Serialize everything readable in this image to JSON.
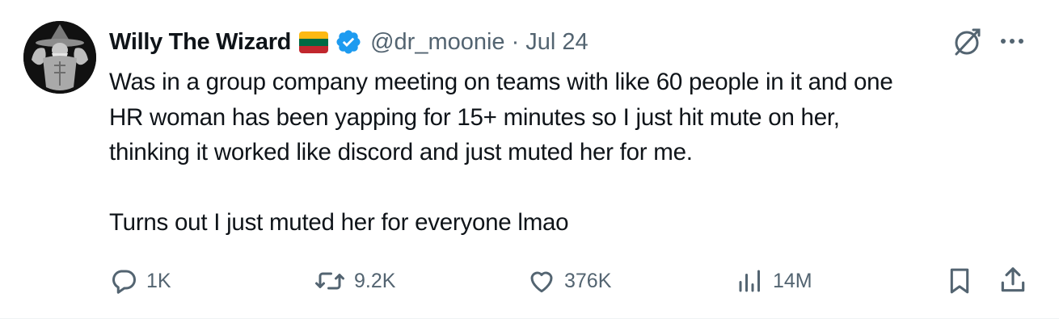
{
  "author": {
    "name": "Willy The Wizard",
    "flag_icon": "lithuania-flag-icon",
    "flag_colors": [
      "#FDB913",
      "#006A44",
      "#C1272D"
    ],
    "verified_icon": "verified-badge-icon",
    "verified_color": "#1D9BF0",
    "handle": "@dr_moonie",
    "separator": "·",
    "date": "Jul 24"
  },
  "tweet": {
    "lines": [
      "Was in a group company meeting on teams with like 60 people in it and one",
      "HR woman has been yapping for 15+ minutes so I just hit mute on her,",
      "thinking it worked like discord and just muted her for me."
    ],
    "final_line": "Turns out I just muted her for everyone lmao"
  },
  "actions": {
    "reply": {
      "icon": "reply-icon",
      "count": "1K"
    },
    "retweet": {
      "icon": "retweet-icon",
      "count": "9.2K"
    },
    "like": {
      "icon": "heart-icon",
      "count": "376K"
    },
    "views": {
      "icon": "views-icon",
      "count": "14M"
    },
    "bookmark": {
      "icon": "bookmark-icon"
    },
    "share": {
      "icon": "share-icon"
    }
  },
  "top_right": {
    "grok": {
      "icon": "grok-icon"
    },
    "more": {
      "icon": "more-icon"
    }
  },
  "colors": {
    "text": "#0F1419",
    "secondary": "#536471",
    "divider": "#EFF3F4"
  }
}
